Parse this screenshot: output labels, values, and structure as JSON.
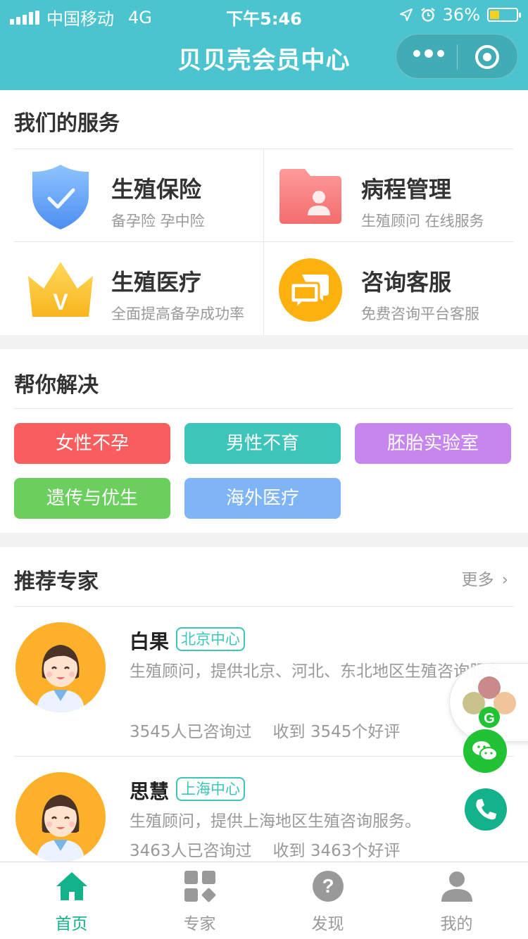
{
  "status_bar": {
    "carrier": "中国移动",
    "network": "4G",
    "time": "下午5:46",
    "battery": "36%",
    "battery_level": 0.36
  },
  "nav": {
    "title": "贝贝壳会员中心"
  },
  "services": {
    "title": "我们的服务",
    "items": [
      {
        "name": "生殖保险",
        "desc": "备孕险 孕中险",
        "icon": "shield-check-icon"
      },
      {
        "name": "病程管理",
        "desc": "生殖顾问 在线服务",
        "icon": "folder-user-icon"
      },
      {
        "name": "生殖医疗",
        "desc": "全面提高备孕成功率",
        "icon": "crown-v-icon"
      },
      {
        "name": "咨询客服",
        "desc": "免费咨询平台客服",
        "icon": "chat-bubbles-icon"
      }
    ]
  },
  "solutions": {
    "title": "帮你解决",
    "tags": [
      {
        "label": "女性不孕",
        "color": "#f95d5d"
      },
      {
        "label": "男性不育",
        "color": "#3cc5b8"
      },
      {
        "label": "胚胎实验室",
        "color": "#c786ed"
      },
      {
        "label": "遗传与优生",
        "color": "#6bcf5e"
      },
      {
        "label": "海外医疗",
        "color": "#7fb4f6"
      }
    ]
  },
  "experts": {
    "title": "推荐专家",
    "more": "更多",
    "items": [
      {
        "name": "白果",
        "center": "北京中心",
        "desc": "生殖顾问，提供北京、河北、东北地区生殖咨询服务。",
        "consulted": "3545人已咨询过",
        "praise": "收到 3545个好评"
      },
      {
        "name": "思慧",
        "center": "上海中心",
        "desc": "生殖顾问，提供上海地区生殖咨询服务。",
        "consulted": "3463人已咨询过",
        "praise": "收到 3463个好评"
      }
    ]
  },
  "floating": {
    "wechat_icon": "wechat-icon",
    "phone_icon": "phone-icon",
    "wechat_color": "#21c234",
    "phone_color": "#13b28a"
  },
  "tabbar": {
    "items": [
      {
        "label": "首页",
        "icon": "home-icon",
        "active": true
      },
      {
        "label": "专家",
        "icon": "grid-icon",
        "active": false
      },
      {
        "label": "发现",
        "icon": "question-icon",
        "active": false
      },
      {
        "label": "我的",
        "icon": "user-icon",
        "active": false
      }
    ]
  },
  "colors": {
    "theme": "#4cc4cf",
    "accent": "#13b28a",
    "tag_border": "#3cc5b8"
  }
}
